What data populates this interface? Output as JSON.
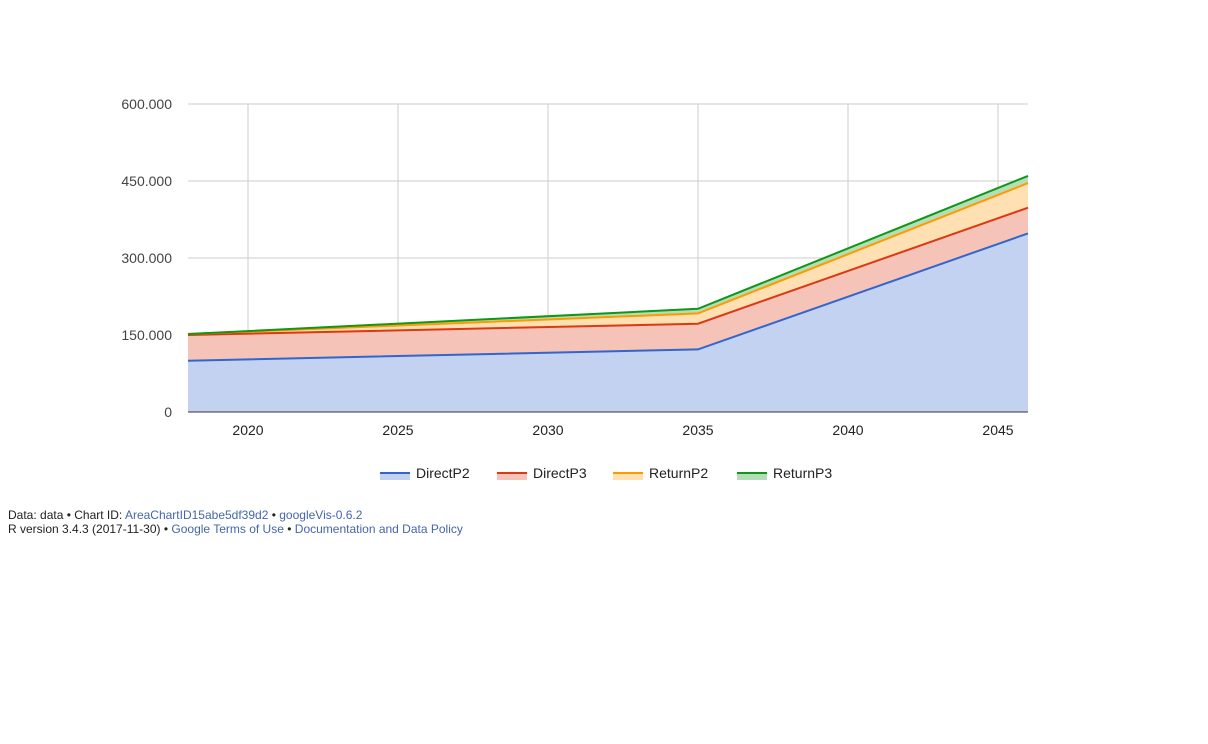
{
  "chart_data": {
    "type": "area",
    "stacked": true,
    "x": [
      2018,
      2035,
      2046
    ],
    "xticks": [
      2020,
      2025,
      2030,
      2035,
      2040,
      2045
    ],
    "xlim": [
      2018,
      2046
    ],
    "ylim": [
      0,
      600000
    ],
    "yticks": [
      0,
      150000,
      300000,
      450000,
      600000
    ],
    "ytick_labels": [
      "0",
      "150.000",
      "300.000",
      "450.000",
      "600.000"
    ],
    "grid": true,
    "legend_position": "bottom",
    "series": [
      {
        "name": "DirectP2",
        "color": "#3366cc",
        "fill": "#c4d2f1",
        "values": [
          100000,
          122000,
          348000
        ]
      },
      {
        "name": "DirectP3",
        "color": "#dc3912",
        "fill": "#f5c3b7",
        "values": [
          50000,
          50000,
          50000
        ]
      },
      {
        "name": "ReturnP2",
        "color": "#ff9900",
        "fill": "#ffe0b2",
        "values": [
          2000,
          20000,
          48000
        ]
      },
      {
        "name": "ReturnP3",
        "color": "#109618",
        "fill": "#b4dfb6",
        "values": [
          0,
          9000,
          14000
        ]
      }
    ]
  },
  "footer": {
    "line1_prefix": "Data: data • Chart ID: ",
    "chart_id_link": "AreaChartID15abe5df39d2",
    "line1_sep": " • ",
    "version_link": "googleVis-0.6.2",
    "line2_prefix": "R version 3.4.3 (2017-11-30) • ",
    "terms_link": "Google Terms of Use",
    "line2_sep": " • ",
    "policy_link": "Documentation and Data Policy"
  }
}
